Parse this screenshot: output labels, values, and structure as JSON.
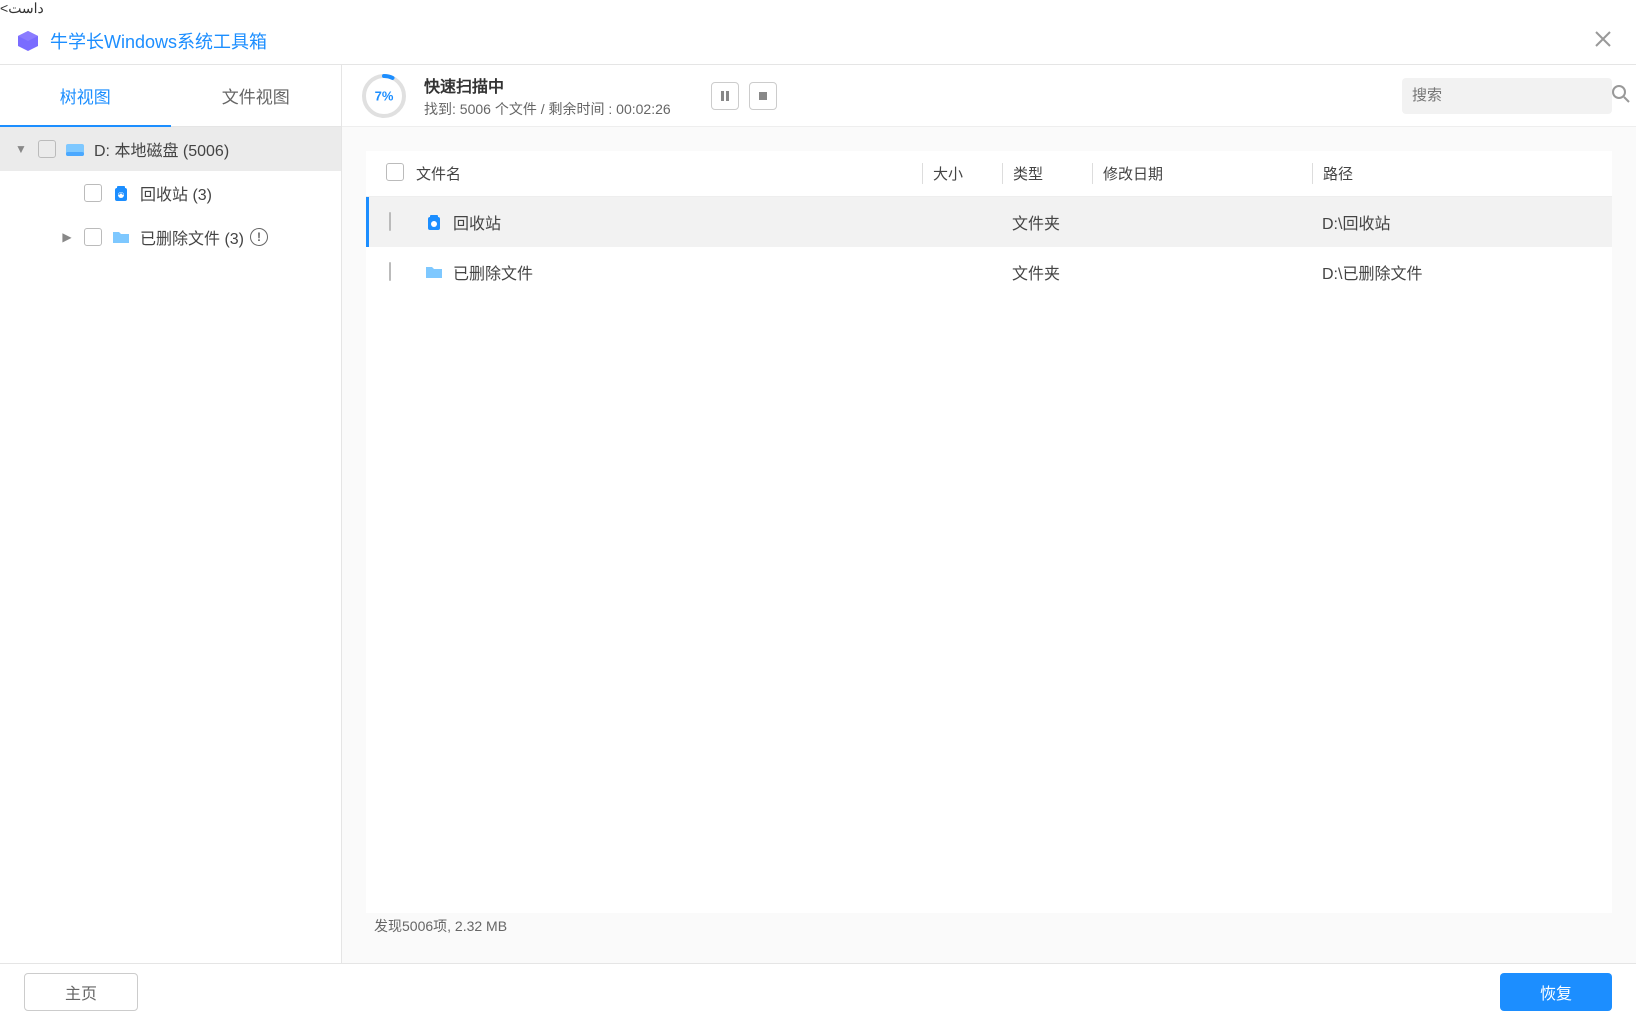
{
  "titlebar": {
    "title": "牛学长Windows系统工具箱"
  },
  "sidebar": {
    "tabs": [
      {
        "label": "树视图",
        "active": true
      },
      {
        "label": "文件视图",
        "active": false
      }
    ],
    "tree": [
      {
        "label": "D: 本地磁盘 (5006)",
        "icon": "disk",
        "selected": true,
        "expanded": true,
        "indent": 0
      },
      {
        "label": "回收站 (3)",
        "icon": "recycle",
        "selected": false,
        "indent": 1
      },
      {
        "label": "已删除文件 (3)",
        "icon": "folder",
        "selected": false,
        "indent": 1,
        "hasExpander": true,
        "hasInfo": true
      }
    ]
  },
  "scan": {
    "percent": "7%",
    "percentValue": 7,
    "title": "快速扫描中",
    "foundLabel": "找到:",
    "foundCount": "5006",
    "foundUnit": "个文件",
    "remainingLabel": "剩余时间 :",
    "remainingTime": "00:02:26"
  },
  "search": {
    "placeholder": "搜索"
  },
  "table": {
    "headers": {
      "name": "文件名",
      "size": "大小",
      "type": "类型",
      "date": "修改日期",
      "path": "路径"
    },
    "rows": [
      {
        "name": "回收站",
        "type": "文件夹",
        "path": "D:\\回收站",
        "icon": "recycle",
        "selected": true
      },
      {
        "name": "已删除文件",
        "type": "文件夹",
        "path": "D:\\已删除文件",
        "icon": "folder",
        "selected": false
      }
    ]
  },
  "statusFooter": "发现5006项, 2.32 MB",
  "bottom": {
    "home": "主页",
    "recover": "恢复"
  },
  "colors": {
    "accent": "#1c8eff"
  }
}
